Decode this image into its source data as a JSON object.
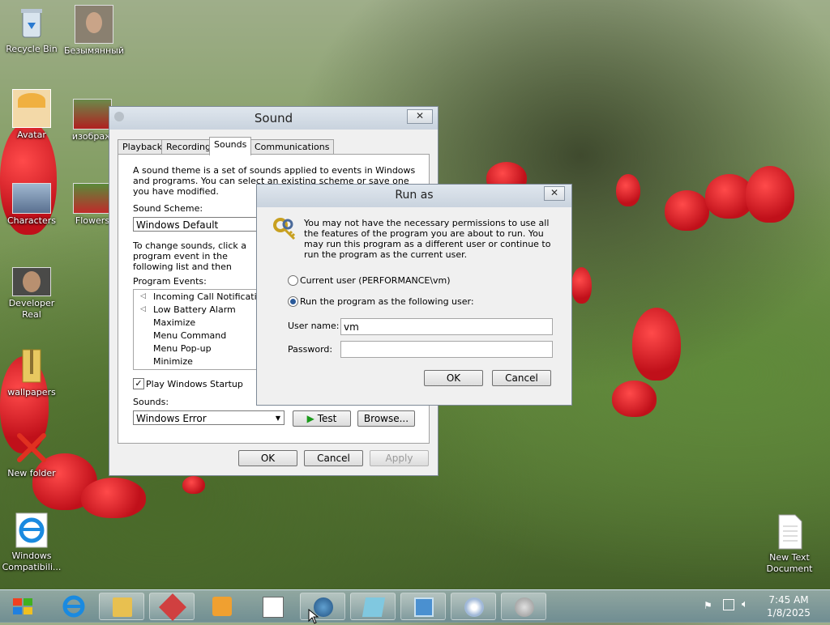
{
  "desktop": {
    "icons": [
      {
        "label": "Recycle Bin"
      },
      {
        "label": "Безымянный"
      },
      {
        "label": "Avatar"
      },
      {
        "label": "изображ"
      },
      {
        "label": "Characters"
      },
      {
        "label": "Flowers"
      },
      {
        "label": "Developer Real"
      },
      {
        "label": "wallpapers"
      },
      {
        "label": "New folder"
      },
      {
        "label": "Windows Compatibili..."
      },
      {
        "label": "New Text Document"
      }
    ]
  },
  "sound_window": {
    "title": "Sound",
    "close_glyph": "✕",
    "tabs": [
      "Playback",
      "Recording",
      "Sounds",
      "Communications"
    ],
    "active_tab": "Sounds",
    "description": "A sound theme is a set of sounds applied to events in Windows and programs. You can select an existing scheme or save one you have modified.",
    "scheme_label": "Sound Scheme:",
    "scheme_value": "Windows Default",
    "change_text": "To change sounds, click a program event in the following list and then select a sound to apply. You can save the changes as a new sound scheme.",
    "program_events_label": "Program Events:",
    "events": [
      "Incoming Call Notification",
      "Low Battery Alarm",
      "Maximize",
      "Menu Command",
      "Menu Pop-up",
      "Minimize"
    ],
    "startup_checkbox": "Play Windows Startup sound",
    "sounds_label": "Sounds:",
    "sounds_value": "Windows Error",
    "test_button": "Test",
    "browse_button": "Browse...",
    "ok_button": "OK",
    "cancel_button": "Cancel",
    "apply_button": "Apply"
  },
  "runas_dialog": {
    "title": "Run as",
    "close_glyph": "✕",
    "message": "You may not have the necessary permissions to use all the features of the program you are about to run. You may run this program as a different user or continue to run the program as the current user.",
    "option_current": "Current user (PERFORMANCE\\vm)",
    "option_other": "Run the program as the following user:",
    "username_label": "User name:",
    "username_value": "vm",
    "password_label": "Password:",
    "password_value": "",
    "ok_button": "OK",
    "cancel_button": "Cancel"
  },
  "taskbar": {
    "clock_time": "7:45 AM",
    "clock_date": "1/8/2025"
  }
}
